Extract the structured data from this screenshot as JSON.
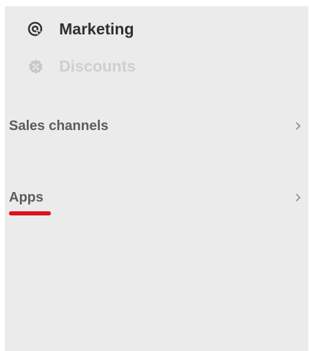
{
  "nav": {
    "marketing": {
      "label": "Marketing",
      "icon": "marketing-target-icon"
    },
    "discounts": {
      "label": "Discounts",
      "icon": "discount-badge-icon"
    }
  },
  "sections": {
    "sales_channels": {
      "label": "Sales channels",
      "icon": "chevron-right-icon"
    },
    "apps": {
      "label": "Apps",
      "icon": "chevron-right-icon"
    }
  },
  "colors": {
    "panel_background": "#ebebeb",
    "active_text": "#303030",
    "disabled_text": "#cfcfcf",
    "section_text": "#5c5c5c",
    "highlight_underline": "#e0101e"
  }
}
